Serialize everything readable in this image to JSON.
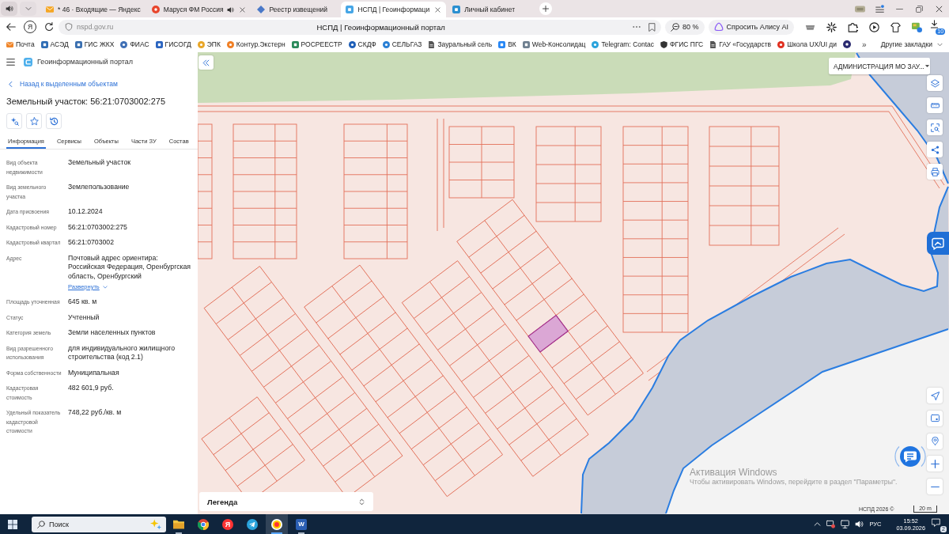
{
  "browser": {
    "tabs": [
      {
        "title": "* 46 · Входящие — Яндекс",
        "kind": "envelope",
        "color": "#f5a623",
        "audio": false,
        "close_button": false,
        "selected": false
      },
      {
        "title": "Маруся ФМ Россия",
        "kind": "round",
        "color": "#e8452c",
        "audio": true,
        "close_button": true,
        "selected": false
      },
      {
        "title": "Реестр извещений",
        "kind": "diamond",
        "color": "#4a78c8",
        "audio": false,
        "close_button": false,
        "selected": false
      },
      {
        "title": "НСПД | Геоинформаци",
        "kind": "square",
        "color": "#46a6e6",
        "audio": false,
        "close_button": true,
        "selected": true
      },
      {
        "title": "Личный кабинет",
        "kind": "square",
        "color": "#2b8fd0",
        "audio": false,
        "close_button": false,
        "selected": false
      }
    ],
    "home_button": "Я",
    "url": "nspd.gov.ru",
    "page_title": "НСПД | Геоинформационный портал",
    "zoom": "80 %",
    "alice": "Спросить Алису AI",
    "downloads": "10",
    "bookmarks": [
      {
        "label": "Почта",
        "kind": "envelope",
        "color": "#f0862a"
      },
      {
        "label": "АСЭД",
        "kind": "square",
        "color": "#2f6db5"
      },
      {
        "label": "ГИС ЖКХ",
        "kind": "square",
        "color": "#3a6fb0"
      },
      {
        "label": "ФИАС",
        "kind": "round",
        "color": "#3f6fb5"
      },
      {
        "label": "ГИСОГД",
        "kind": "square",
        "color": "#2a64c0"
      },
      {
        "label": "ЭПК",
        "kind": "round",
        "color": "#e8a628"
      },
      {
        "label": "Контур.Экстерн",
        "kind": "round",
        "color": "#f07f24"
      },
      {
        "label": "РОСРЕЕСТР",
        "kind": "square",
        "color": "#2a8a5a"
      },
      {
        "label": "СКДФ",
        "kind": "round",
        "color": "#1f5fb8"
      },
      {
        "label": "СЕЛЬГАЗ",
        "kind": "round",
        "color": "#2a7fd4"
      },
      {
        "label": "Зауральный сель",
        "kind": "page",
        "color": "#555555"
      },
      {
        "label": "ВК",
        "kind": "square",
        "color": "#2787f5"
      },
      {
        "label": "Web-Консолидац",
        "kind": "square",
        "color": "#6f8090"
      },
      {
        "label": "Telegram: Contac",
        "kind": "round",
        "color": "#2aa3dc"
      },
      {
        "label": "ФГИС ПГС",
        "kind": "shield",
        "color": "#333333"
      },
      {
        "label": "ГАУ «Государств",
        "kind": "page",
        "color": "#555555"
      },
      {
        "label": "Школа UX/UI ди",
        "kind": "round",
        "color": "#e03020"
      },
      {
        "kind": "round",
        "color": "#2a2a70"
      }
    ],
    "more_bookmarks": "»",
    "other_bookmarks": "Другие закладки"
  },
  "portal": {
    "title": "Геоинформационный портал",
    "back_link": "Назад к выделенным объектам",
    "heading": "Земельный участок: 56:21:0703002:275",
    "tabs": [
      {
        "label": "Информация",
        "selected": true
      },
      {
        "label": "Сервисы",
        "selected": false
      },
      {
        "label": "Объекты",
        "selected": false
      },
      {
        "label": "Части ЗУ",
        "selected": false
      },
      {
        "label": "Состав",
        "selected": false
      }
    ],
    "properties": [
      {
        "label": "Вид объекта недвижимости",
        "value": "Земельный участок"
      },
      {
        "label": "Вид земельного участка",
        "value": "Землепользование"
      },
      {
        "label": "Дата присвоения",
        "value": "10.12.2024"
      },
      {
        "label": "Кадастровый номер",
        "value": "56:21:0703002:275"
      },
      {
        "label": "Кадастровый квартал",
        "value": "56:21:0703002"
      },
      {
        "label": "Адрес",
        "value": "Почтовый адрес ориентира: Российская Федерация, Оренбургская область, Оренбургский",
        "expand_link": "Развернуть"
      },
      {
        "label": "Площадь уточненная",
        "value": "645 кв. м"
      },
      {
        "label": "Статус",
        "value": "Учтенный"
      },
      {
        "label": "Категория земель",
        "value": "Земли населенных пунктов"
      },
      {
        "label": "Вид разрешенного использования",
        "value": "для индивидуального жилищного строительства (код 2.1)"
      },
      {
        "label": "Форма собственности",
        "value": "Муниципальная"
      },
      {
        "label": "Кадастровая стоимость",
        "value": "482 601,9 руб."
      },
      {
        "label": "Удельный показатель кадастровой стоимости",
        "value": "748,22 руб./кв. м"
      }
    ]
  },
  "map": {
    "region_select": "АДМИНИСТРАЦИЯ МО ЗАУ...",
    "legend": "Легенда",
    "copyright": "НСПД 2026 ©",
    "scale": "20 m"
  },
  "windows_notice": {
    "title": "Активация Windows",
    "text": "Чтобы активировать Windows, перейдите в раздел \"Параметры\"."
  },
  "taskbar": {
    "search_placeholder": "Поиск",
    "apps": [
      {
        "kind": "files",
        "selected": false,
        "running": true
      },
      {
        "kind": "chrome",
        "selected": false,
        "running": false
      },
      {
        "kind": "yandex",
        "label": "Я",
        "selected": false,
        "running": false
      },
      {
        "kind": "telegram",
        "selected": false,
        "running": false
      },
      {
        "kind": "yandex-browser",
        "selected": true,
        "running": true
      },
      {
        "kind": "word",
        "label": "W",
        "selected": false,
        "running": true
      }
    ],
    "language": "РУС",
    "time": "15:52",
    "date": "03.09.2026",
    "notifications": "2"
  }
}
